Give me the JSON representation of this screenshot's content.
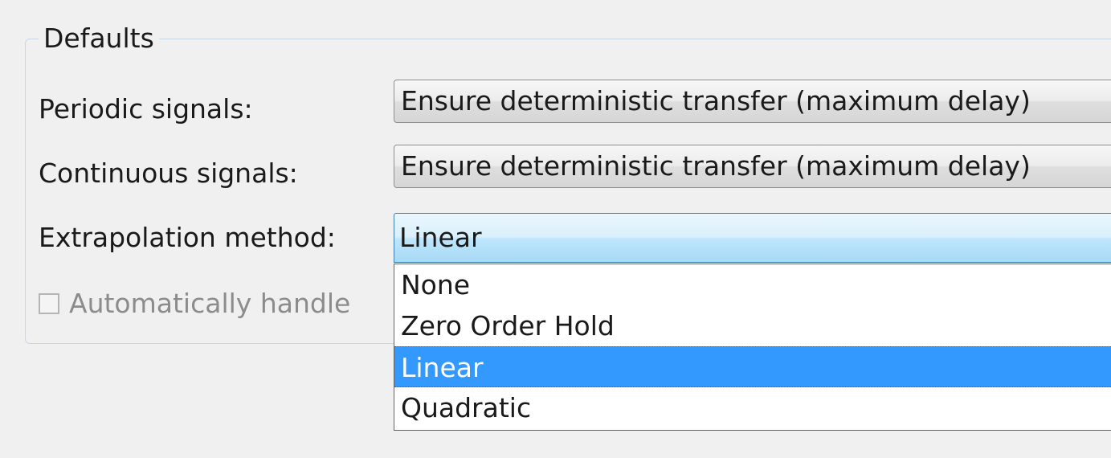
{
  "group": {
    "title": "Defaults"
  },
  "fields": {
    "periodic_label": "Periodic signals:",
    "periodic_value": "Ensure deterministic transfer (maximum delay)",
    "continuous_label": "Continuous signals:",
    "continuous_value": "Ensure deterministic transfer (maximum delay)",
    "extrapolation_label": "Extrapolation method:",
    "extrapolation_value": "Linear"
  },
  "checkbox": {
    "label": "Automatically handle",
    "checked": false
  },
  "dropdown": {
    "options": [
      "None",
      "Zero Order Hold",
      "Linear",
      "Quadratic"
    ],
    "selected_index": 2
  },
  "colors": {
    "selection": "#3399ff",
    "active_combo": "#bee6fd"
  }
}
